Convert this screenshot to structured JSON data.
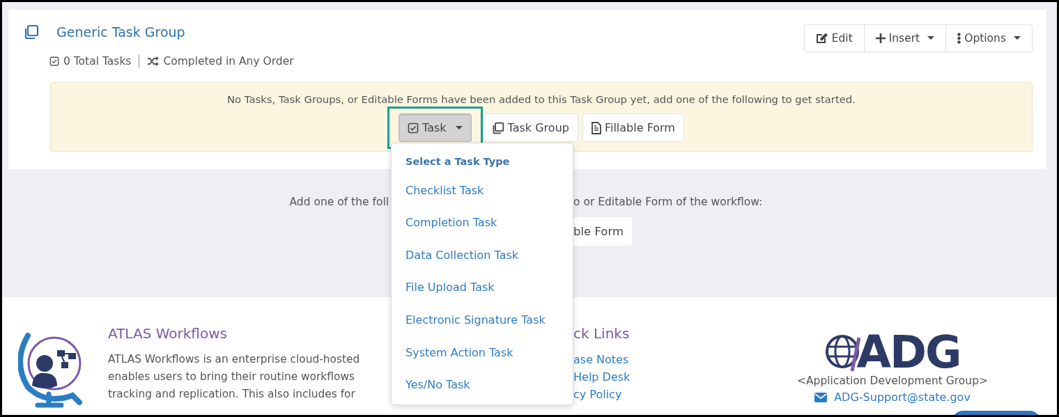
{
  "task_group": {
    "title": "Generic Task Group",
    "total_tasks": "0 Total Tasks",
    "order": "Completed in Any Order"
  },
  "toolbar": [
    {
      "label": "Edit",
      "kind": "edit"
    },
    {
      "label": "Insert",
      "kind": "insert"
    },
    {
      "label": "Options",
      "kind": "options"
    }
  ],
  "empty_notice": {
    "message": "No Tasks, Task Groups, or Editable Forms have been added to this Task Group yet, add one of the following to get started.",
    "buttons": [
      {
        "label": "Task",
        "kind": "task",
        "selected": true
      },
      {
        "label": "Task Group",
        "kind": "group",
        "selected": false
      },
      {
        "label": "Fillable Form",
        "kind": "form",
        "selected": false
      }
    ]
  },
  "task_type_menu": {
    "header": "Select a Task Type",
    "items": [
      "Checklist Task",
      "Completion Task",
      "Data Collection Task",
      "File Upload Task",
      "Electronic Signature Task",
      "System Action Task",
      "Yes/No Task"
    ]
  },
  "workflow_add": {
    "text_before": "Add one of the foll",
    "text_after": "o or Editable Form of the workflow:",
    "button_fragment": "ble Form"
  },
  "footer": {
    "app_title": "ATLAS Workflows",
    "description_lines": [
      "ATLAS Workflows is an enterprise cloud-hosted",
      "enables users to bring their routine workflows",
      "tracking and replication. This also includes for"
    ],
    "quick_links_title": "ck Links",
    "quick_links": [
      "ase Notes",
      "Help Desk",
      "cy Policy"
    ],
    "org_logo": "ADG",
    "org_name": "<Application Development Group>",
    "support_email": "ADG-Support@state.gov"
  }
}
